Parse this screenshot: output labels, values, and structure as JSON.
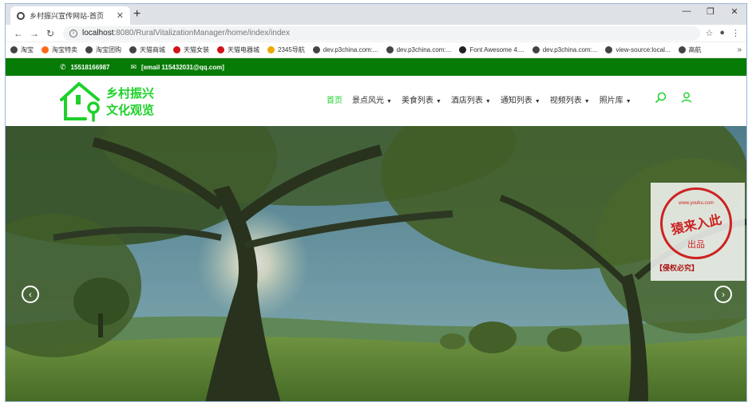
{
  "browser": {
    "tab_title": "乡村振兴宣传网站-首页",
    "tab_close": "✕",
    "new_tab": "+",
    "window_controls": {
      "minimize": "—",
      "maximize": "❐",
      "close": "✕"
    },
    "nav": {
      "back": "←",
      "forward": "→",
      "reload": "↻"
    },
    "url_host": "localhost",
    "url_rest": ":8080/RuralVitalizationManager/home/index/index",
    "toolbar_right": {
      "star": "☆",
      "profile": "●",
      "menu": "⋮"
    },
    "bookmarks": [
      {
        "label": "淘宝",
        "color": "#444444"
      },
      {
        "label": "淘宝特卖",
        "color": "#ff6a1a"
      },
      {
        "label": "淘宝团购",
        "color": "#444444"
      },
      {
        "label": "天猫商城",
        "color": "#444444"
      },
      {
        "label": "天猫女装",
        "color": "#d3121b"
      },
      {
        "label": "天猫电器城",
        "color": "#d3121b"
      },
      {
        "label": "2345导航",
        "color": "#f0a800"
      },
      {
        "label": "dev.p3china.com:...",
        "color": "#444444"
      },
      {
        "label": "dev.p3china.com:...",
        "color": "#444444"
      },
      {
        "label": "Font Awesome 4....",
        "color": "#222222"
      },
      {
        "label": "dev.p3china.com:...",
        "color": "#444444"
      },
      {
        "label": "view-source:local...",
        "color": "#444444"
      },
      {
        "label": "高航",
        "color": "#444444"
      }
    ],
    "bookmarks_more": "»"
  },
  "site": {
    "topbar": {
      "phone": "15518166987",
      "email": "[email 115432031@qq.com]",
      "bg": "#067b06"
    },
    "logo": {
      "line1": "乡村振兴",
      "line2": "文化观览",
      "color": "#1dd12a"
    },
    "nav": [
      {
        "label": "首页",
        "active": true,
        "dropdown": false
      },
      {
        "label": "景点风光",
        "active": false,
        "dropdown": true
      },
      {
        "label": "美食列表",
        "active": false,
        "dropdown": true
      },
      {
        "label": "酒店列表",
        "active": false,
        "dropdown": true
      },
      {
        "label": "通知列表",
        "active": false,
        "dropdown": true
      },
      {
        "label": "视频列表",
        "active": false,
        "dropdown": true
      },
      {
        "label": "照片库",
        "active": false,
        "dropdown": true
      }
    ],
    "header_icons": [
      "search-icon",
      "user-icon"
    ],
    "hero": {
      "prev": "‹",
      "next": "›"
    }
  },
  "watermark": {
    "url": "www.youhu.com",
    "main": "猿来入此",
    "sub": "出品",
    "footer": "【侵权必究】"
  }
}
